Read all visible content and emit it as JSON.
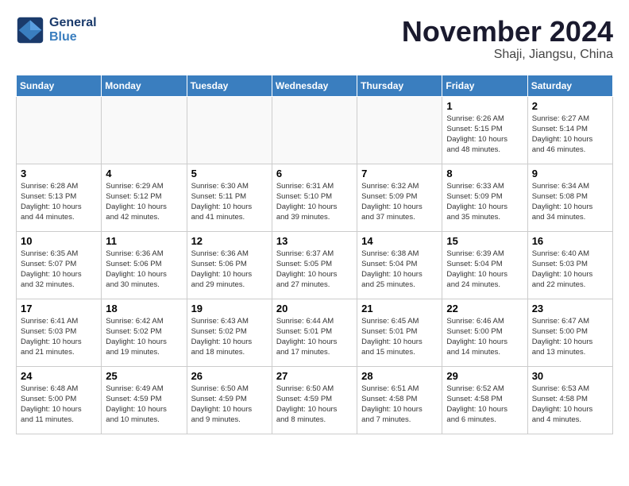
{
  "logo": {
    "line1": "General",
    "line2": "Blue"
  },
  "title": "November 2024",
  "location": "Shaji, Jiangsu, China",
  "days_of_week": [
    "Sunday",
    "Monday",
    "Tuesday",
    "Wednesday",
    "Thursday",
    "Friday",
    "Saturday"
  ],
  "weeks": [
    [
      {
        "day": "",
        "info": ""
      },
      {
        "day": "",
        "info": ""
      },
      {
        "day": "",
        "info": ""
      },
      {
        "day": "",
        "info": ""
      },
      {
        "day": "",
        "info": ""
      },
      {
        "day": "1",
        "info": "Sunrise: 6:26 AM\nSunset: 5:15 PM\nDaylight: 10 hours\nand 48 minutes."
      },
      {
        "day": "2",
        "info": "Sunrise: 6:27 AM\nSunset: 5:14 PM\nDaylight: 10 hours\nand 46 minutes."
      }
    ],
    [
      {
        "day": "3",
        "info": "Sunrise: 6:28 AM\nSunset: 5:13 PM\nDaylight: 10 hours\nand 44 minutes."
      },
      {
        "day": "4",
        "info": "Sunrise: 6:29 AM\nSunset: 5:12 PM\nDaylight: 10 hours\nand 42 minutes."
      },
      {
        "day": "5",
        "info": "Sunrise: 6:30 AM\nSunset: 5:11 PM\nDaylight: 10 hours\nand 41 minutes."
      },
      {
        "day": "6",
        "info": "Sunrise: 6:31 AM\nSunset: 5:10 PM\nDaylight: 10 hours\nand 39 minutes."
      },
      {
        "day": "7",
        "info": "Sunrise: 6:32 AM\nSunset: 5:09 PM\nDaylight: 10 hours\nand 37 minutes."
      },
      {
        "day": "8",
        "info": "Sunrise: 6:33 AM\nSunset: 5:09 PM\nDaylight: 10 hours\nand 35 minutes."
      },
      {
        "day": "9",
        "info": "Sunrise: 6:34 AM\nSunset: 5:08 PM\nDaylight: 10 hours\nand 34 minutes."
      }
    ],
    [
      {
        "day": "10",
        "info": "Sunrise: 6:35 AM\nSunset: 5:07 PM\nDaylight: 10 hours\nand 32 minutes."
      },
      {
        "day": "11",
        "info": "Sunrise: 6:36 AM\nSunset: 5:06 PM\nDaylight: 10 hours\nand 30 minutes."
      },
      {
        "day": "12",
        "info": "Sunrise: 6:36 AM\nSunset: 5:06 PM\nDaylight: 10 hours\nand 29 minutes."
      },
      {
        "day": "13",
        "info": "Sunrise: 6:37 AM\nSunset: 5:05 PM\nDaylight: 10 hours\nand 27 minutes."
      },
      {
        "day": "14",
        "info": "Sunrise: 6:38 AM\nSunset: 5:04 PM\nDaylight: 10 hours\nand 25 minutes."
      },
      {
        "day": "15",
        "info": "Sunrise: 6:39 AM\nSunset: 5:04 PM\nDaylight: 10 hours\nand 24 minutes."
      },
      {
        "day": "16",
        "info": "Sunrise: 6:40 AM\nSunset: 5:03 PM\nDaylight: 10 hours\nand 22 minutes."
      }
    ],
    [
      {
        "day": "17",
        "info": "Sunrise: 6:41 AM\nSunset: 5:03 PM\nDaylight: 10 hours\nand 21 minutes."
      },
      {
        "day": "18",
        "info": "Sunrise: 6:42 AM\nSunset: 5:02 PM\nDaylight: 10 hours\nand 19 minutes."
      },
      {
        "day": "19",
        "info": "Sunrise: 6:43 AM\nSunset: 5:02 PM\nDaylight: 10 hours\nand 18 minutes."
      },
      {
        "day": "20",
        "info": "Sunrise: 6:44 AM\nSunset: 5:01 PM\nDaylight: 10 hours\nand 17 minutes."
      },
      {
        "day": "21",
        "info": "Sunrise: 6:45 AM\nSunset: 5:01 PM\nDaylight: 10 hours\nand 15 minutes."
      },
      {
        "day": "22",
        "info": "Sunrise: 6:46 AM\nSunset: 5:00 PM\nDaylight: 10 hours\nand 14 minutes."
      },
      {
        "day": "23",
        "info": "Sunrise: 6:47 AM\nSunset: 5:00 PM\nDaylight: 10 hours\nand 13 minutes."
      }
    ],
    [
      {
        "day": "24",
        "info": "Sunrise: 6:48 AM\nSunset: 5:00 PM\nDaylight: 10 hours\nand 11 minutes."
      },
      {
        "day": "25",
        "info": "Sunrise: 6:49 AM\nSunset: 4:59 PM\nDaylight: 10 hours\nand 10 minutes."
      },
      {
        "day": "26",
        "info": "Sunrise: 6:50 AM\nSunset: 4:59 PM\nDaylight: 10 hours\nand 9 minutes."
      },
      {
        "day": "27",
        "info": "Sunrise: 6:50 AM\nSunset: 4:59 PM\nDaylight: 10 hours\nand 8 minutes."
      },
      {
        "day": "28",
        "info": "Sunrise: 6:51 AM\nSunset: 4:58 PM\nDaylight: 10 hours\nand 7 minutes."
      },
      {
        "day": "29",
        "info": "Sunrise: 6:52 AM\nSunset: 4:58 PM\nDaylight: 10 hours\nand 6 minutes."
      },
      {
        "day": "30",
        "info": "Sunrise: 6:53 AM\nSunset: 4:58 PM\nDaylight: 10 hours\nand 4 minutes."
      }
    ]
  ]
}
